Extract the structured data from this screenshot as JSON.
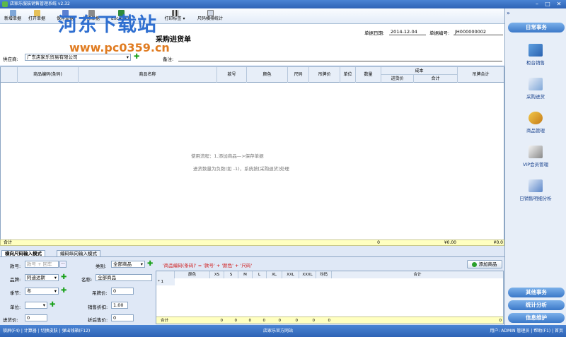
{
  "window": {
    "title": "店家乐服装销售管理系统 v2.32",
    "min": "–",
    "max": "□",
    "close": "✕"
  },
  "toolbar": {
    "buttons": [
      {
        "label": "新增单据",
        "icon": "new-document-icon"
      },
      {
        "label": "打开单据",
        "icon": "open-document-icon"
      },
      {
        "label": "保存单据",
        "icon": "save-document-icon"
      },
      {
        "label": "打印单据",
        "icon": "print-icon"
      },
      {
        "label": "Excel导入",
        "icon": "excel-icon"
      },
      {
        "label": "打印标签",
        "icon": "barcode-icon"
      },
      {
        "label": "尺码横排统计",
        "icon": "size-stats-icon"
      }
    ]
  },
  "watermark": {
    "text": "河东下载站",
    "url": "www.pc0359.cn"
  },
  "form": {
    "title": "采购进货单",
    "date_label": "单据日期:",
    "date_value": "2014-12-04",
    "number_label": "单据编号:",
    "number_value": "JH000000002",
    "supplier_label": "供应商:",
    "supplier_value": "广东店家乐贸易有限公司",
    "remark_label": "备注:"
  },
  "grid": {
    "columns": [
      "商品编码(条码)",
      "商品名称",
      "款号",
      "颜色",
      "尺码",
      "吊牌价",
      "单位",
      "数量",
      "成本",
      "进货价",
      "合计",
      "吊牌合计"
    ],
    "hint1": "使用流程：1.添加商品—>保存单据",
    "hint2": "进货数量为负数(如 -1)，系统按[采购退货]处理",
    "total_label": "合计",
    "total_qty": "0",
    "total_cost": "¥0.00",
    "total_tag": "¥0.0"
  },
  "tabs": [
    "横向尺码输入模式",
    "编码纵向输入模式"
  ],
  "entry": {
    "style_label": "款号:",
    "style_placeholder": "款号 + 回车",
    "category_label": "类别:",
    "category_value": "全部商品",
    "formula": "'商品编码(条码)' = '款号' + '颜色' + '尺码'",
    "add_button": "添加商品",
    "brand_label": "品牌:",
    "brand_value": "阿迪达斯",
    "name_label": "名称:",
    "name_value": "全部商品",
    "season_label": "季节:",
    "season_value": "冬",
    "tag_price_label": "吊牌价:",
    "tag_price_value": "0",
    "unit_label": "单位:",
    "discount_label": "销售折扣:",
    "discount_value": "1.00",
    "purchase_price_label": "进货价:",
    "purchase_price_value": "0",
    "discount_price_label": "折后售价:",
    "discount_price_value": "0"
  },
  "subgrid": {
    "columns": [
      "颜色",
      "XS",
      "S",
      "M",
      "L",
      "XL",
      "XXL",
      "XXXL",
      "均码",
      "合计"
    ],
    "new_row": "* 1",
    "total_label": "合计",
    "totals": [
      "0",
      "0",
      "0",
      "0",
      "0",
      "0",
      "0",
      "0",
      "0"
    ]
  },
  "status": {
    "left": "锁屏(F4) | 计算器 | 切换皮肤 | 弹出钱箱(F12)",
    "center": "店家乐官方网站",
    "right": "用户: ADMIN 管理员 | 帮助(F1) | 首页"
  },
  "sidebar": {
    "collapse": "»",
    "daily": "日常事务",
    "items": [
      {
        "label": "柜台销售",
        "icon": "cashier-icon"
      },
      {
        "label": "采购进货",
        "icon": "purchase-icon"
      },
      {
        "label": "商品管理",
        "icon": "goods-icon"
      },
      {
        "label": "VIP会员管理",
        "icon": "vip-icon"
      },
      {
        "label": "日销售明细分析",
        "icon": "analysis-icon"
      }
    ],
    "other": "其他事务",
    "stats": "统计分析",
    "info": "信息维护"
  }
}
